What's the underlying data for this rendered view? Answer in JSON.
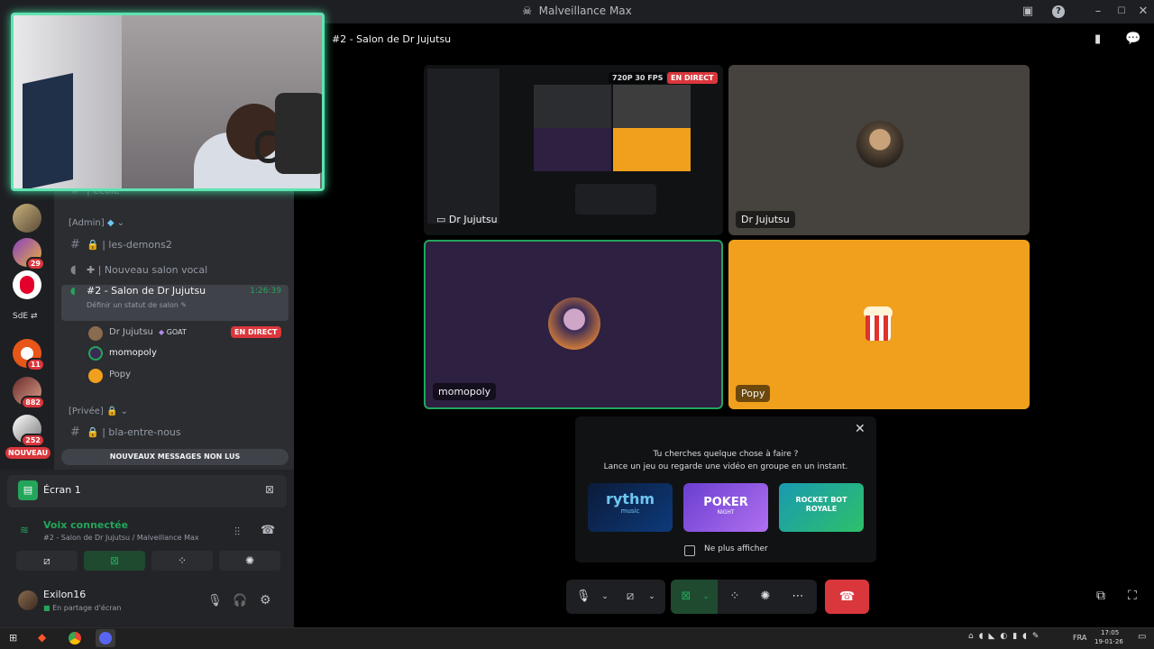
{
  "window": {
    "title": "Malveillance Max"
  },
  "header": {
    "channel_title": "#2 - Salon de Dr Jujutsu"
  },
  "rail": {
    "badges": [
      "29",
      "11",
      "882",
      "252"
    ],
    "sde_label": "SdE",
    "nouveau_label": "NOUVEAU"
  },
  "channels": {
    "partial_top": "| école",
    "admin_category": "[Admin]",
    "items": [
      {
        "label": "| les-demons2"
      },
      {
        "label": "| Nouveau salon vocal"
      }
    ],
    "active_voice": {
      "label": "#2 - Salon de Dr Jujutsu",
      "timer": "1:26:39",
      "status_hint": "Définir un statut de salon"
    },
    "members": [
      {
        "name": "Dr Jujutsu",
        "tag": "GOAT",
        "live": "EN DIRECT"
      },
      {
        "name": "momopoly"
      },
      {
        "name": "Popy"
      }
    ],
    "private_category": "[Privée]",
    "private_item": "| bla-entre-nous",
    "unread_banner": "NOUVEAUX MESSAGES NON LUS"
  },
  "stream_panel": {
    "label": "Écran 1"
  },
  "voice": {
    "status": "Voix connectée",
    "location": "#2 - Salon de Dr Jujutsu / Malveillance Max"
  },
  "user": {
    "name": "Exilon16",
    "status": "En partage d'écran"
  },
  "tiles": [
    {
      "name": "Dr Jujutsu",
      "kind": "stream",
      "quality": "720P 30 FPS",
      "live": "EN DIRECT"
    },
    {
      "name": "Dr Jujutsu",
      "kind": "camera"
    },
    {
      "name": "momopoly",
      "kind": "avatar"
    },
    {
      "name": "Popy",
      "kind": "avatar"
    }
  ],
  "activity": {
    "line1": "Tu cherches quelque chose à faire ?",
    "line2": "Lance un jeu ou regarde une vidéo en groupe en un instant.",
    "cards": [
      {
        "label": "rythm",
        "sub": "music"
      },
      {
        "label": "POKER",
        "sub": "NIGHT"
      },
      {
        "label": "ROCKET BOT ROYALE",
        "sub": ""
      }
    ],
    "dont_show": "Ne plus afficher"
  },
  "taskbar": {
    "lang": "FRA",
    "time": "17:05",
    "date": "19-01-26"
  },
  "colors": {
    "accent_green": "#23a55a",
    "live_red": "#da373c",
    "end_call": "#da373c",
    "popy_bg": "#f0a01c",
    "momo_bg": "#2e2041"
  }
}
